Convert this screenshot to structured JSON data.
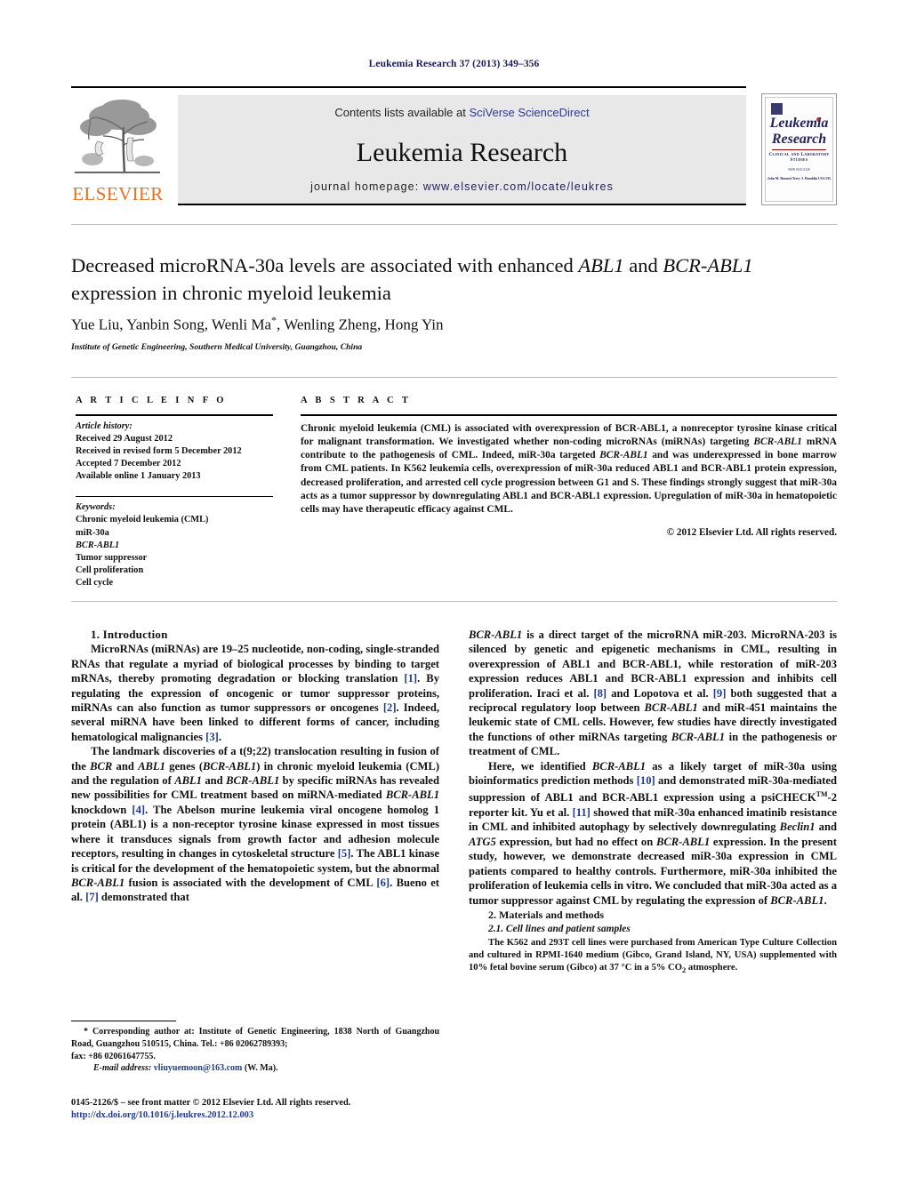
{
  "running_head": "Leukemia Research 37 (2013) 349–356",
  "masthead": {
    "contents_prefix": "Contents lists available at ",
    "contents_link": "SciVerse ScienceDirect",
    "journal_name": "Leukemia Research",
    "homepage_label": "journal homepage: ",
    "homepage_url": "www.elsevier.com/locate/leukres",
    "publisher_logo_text": "ELSEVIER",
    "cover": {
      "title_line1": "Leukemia",
      "title_line2": "Research",
      "subtitle": "Clinical and Laboratory Studies",
      "issn_line": "ISSN 0145-2126",
      "editors": "John M. Bennett          Terry J. Hamblin\nUSA                                 UK"
    }
  },
  "article": {
    "title_part1": "Decreased microRNA-30a levels are associated with enhanced ",
    "title_italic1": "ABL1",
    "title_part2": " and ",
    "title_italic2": "BCR-ABL1",
    "title_part3": " expression in chronic myeloid leukemia",
    "authors": "Yue Liu, Yanbin Song, Wenli Ma",
    "corresponding_mark": "*",
    "authors_rest": ", Wenling Zheng, Hong Yin",
    "affiliation": "Institute of Genetic Engineering, Southern Medical University, Guangzhou, China"
  },
  "article_info": {
    "heading": "A R T I C L E   I N F O",
    "history_label": "Article history:",
    "history": [
      "Received 29 August 2012",
      "Received in revised form 5 December 2012",
      "Accepted 7 December 2012",
      "Available online 1 January 2013"
    ],
    "keywords_label": "Keywords:",
    "keywords": [
      "Chronic myeloid leukemia (CML)",
      "miR-30a",
      "BCR-ABL1",
      "Tumor suppressor",
      "Cell proliferation",
      "Cell cycle"
    ],
    "keyword_italic_index": 2
  },
  "abstract": {
    "heading": "A B S T R A C T",
    "segments": [
      {
        "t": "Chronic myeloid leukemia (CML) is associated with overexpression of BCR-ABL1, a nonreceptor tyrosine kinase critical for malignant transformation. We investigated whether non-coding microRNAs (miRNAs) targeting "
      },
      {
        "t": "BCR-ABL1",
        "i": true
      },
      {
        "t": " mRNA contribute to the pathogenesis of CML. Indeed, miR-30a targeted "
      },
      {
        "t": "BCR-ABL1",
        "i": true
      },
      {
        "t": " and was underexpressed in bone marrow from CML patients. In K562 leukemia cells, overexpression of miR-30a reduced ABL1 and BCR-ABL1 protein expression, decreased proliferation, and arrested cell cycle progression between G1 and S. These findings strongly suggest that miR-30a acts as a tumor suppressor by downregulating ABL1 and BCR-ABL1 expression. Upregulation of miR-30a in hematopoietic cells may have therapeutic efficacy against CML."
      }
    ],
    "copyright": "© 2012 Elsevier Ltd. All rights reserved."
  },
  "body": {
    "intro_heading": "1.  Introduction",
    "intro_p1": [
      {
        "t": "MicroRNAs (miRNAs) are 19–25 nucleotide, non-coding, single-stranded RNAs that regulate a myriad of biological processes by binding to target mRNAs, thereby promoting degradation or blocking translation "
      },
      {
        "t": "[1]",
        "r": true
      },
      {
        "t": ". By regulating the expression of oncogenic or tumor suppressor proteins, miRNAs can also function as tumor suppressors or oncogenes "
      },
      {
        "t": "[2]",
        "r": true
      },
      {
        "t": ". Indeed, several miRNA have been linked to different forms of cancer, including hematological malignancies "
      },
      {
        "t": "[3]",
        "r": true
      },
      {
        "t": "."
      }
    ],
    "intro_p2": [
      {
        "t": "The landmark discoveries of a t(9;22) translocation resulting in fusion of the "
      },
      {
        "t": "BCR",
        "i": true
      },
      {
        "t": " and "
      },
      {
        "t": "ABL1",
        "i": true
      },
      {
        "t": " genes ("
      },
      {
        "t": "BCR-ABL1",
        "i": true
      },
      {
        "t": ") in chronic myeloid leukemia (CML) and the regulation of "
      },
      {
        "t": "ABL1",
        "i": true
      },
      {
        "t": " and "
      },
      {
        "t": "BCR-ABL1",
        "i": true
      },
      {
        "t": " by specific miRNAs has revealed new possibilities for CML treatment based on miRNA-mediated "
      },
      {
        "t": "BCR-ABL1",
        "i": true
      },
      {
        "t": " knockdown "
      },
      {
        "t": "[4]",
        "r": true
      },
      {
        "t": ". The Abelson murine leukemia viral oncogene homolog 1 protein (ABL1) is a non-receptor tyrosine kinase expressed in most tissues where it transduces signals from growth factor and adhesion molecule receptors, resulting in changes in cytoskeletal structure "
      },
      {
        "t": "[5]",
        "r": true
      },
      {
        "t": ". The ABL1 kinase is critical for the development of the hematopoietic system, but the abnormal "
      },
      {
        "t": "BCR-ABL1",
        "i": true
      },
      {
        "t": " fusion is associated with the development of CML "
      },
      {
        "t": "[6]",
        "r": true
      },
      {
        "t": ". Bueno et al. "
      },
      {
        "t": "[7]",
        "r": true
      },
      {
        "t": " demonstrated that"
      }
    ],
    "right_p1": [
      {
        "t": "BCR-ABL1",
        "i": true
      },
      {
        "t": " is a direct target of the microRNA miR-203. MicroRNA-203 is silenced by genetic and epigenetic mechanisms in CML, resulting in overexpression of ABL1 and BCR-ABL1, while restoration of miR-203 expression reduces ABL1 and BCR-ABL1 expression and inhibits cell proliferation. Iraci et al. "
      },
      {
        "t": "[8]",
        "r": true
      },
      {
        "t": " and Lopotova et al. "
      },
      {
        "t": "[9]",
        "r": true
      },
      {
        "t": " both suggested that a reciprocal regulatory loop between "
      },
      {
        "t": "BCR-ABL1",
        "i": true
      },
      {
        "t": " and miR-451 maintains the leukemic state of CML cells. However, few studies have directly investigated the functions of other miRNAs targeting "
      },
      {
        "t": "BCR-ABL1",
        "i": true
      },
      {
        "t": " in the pathogenesis or treatment of CML."
      }
    ],
    "right_p2": [
      {
        "t": "Here, we identified "
      },
      {
        "t": "BCR-ABL1",
        "i": true
      },
      {
        "t": " as a likely target of miR-30a using bioinformatics prediction methods "
      },
      {
        "t": "[10]",
        "r": true
      },
      {
        "t": " and demonstrated miR-30a-mediated suppression of ABL1 and BCR-ABL1 expression using a psiCHECK"
      },
      {
        "t": "TM",
        "sup": true
      },
      {
        "t": "-2 reporter kit. Yu et al. "
      },
      {
        "t": "[11]",
        "r": true
      },
      {
        "t": " showed that miR-30a enhanced imatinib resistance in CML and inhibited autophagy by selectively downregulating "
      },
      {
        "t": "Beclin1",
        "i": true
      },
      {
        "t": " and "
      },
      {
        "t": "ATG5",
        "i": true
      },
      {
        "t": " expression, but had no effect on "
      },
      {
        "t": "BCR-ABL1",
        "i": true
      },
      {
        "t": " expression. In the present study, however, we demonstrate decreased miR-30a expression in CML patients compared to healthy controls. Furthermore, miR-30a inhibited the proliferation of leukemia cells in vitro. We concluded that miR-30a acted as a tumor suppressor against CML by regulating the expression of "
      },
      {
        "t": "BCR-ABL1",
        "i": true
      },
      {
        "t": "."
      }
    ],
    "methods_heading": "2.  Materials and methods",
    "methods_sub": "2.1.   Cell lines and patient samples",
    "methods_p1_a": "The K562 and 293T cell lines were purchased from American Type Culture Collection and cultured in RPMI-1640 medium (Gibco, Grand Island, NY, USA) supplemented with 10% fetal bovine serum (Gibco) at 37 °C in a 5% CO",
    "methods_p1_sub": "2",
    "methods_p1_b": " atmosphere."
  },
  "footnote": {
    "text": "* Corresponding author at: Institute of Genetic Engineering, 1838 North of Guangzhou Road, Guangzhou 510515, China. Tel.: +86 02062789393;",
    "fax": "fax: +86 02061647755.",
    "email_label": "E-mail address:",
    "email": "vliuyuemoon@163.com",
    "email_suffix": " (W. Ma)."
  },
  "imprint": {
    "line1": "0145-2126/$ – see front matter © 2012 Elsevier Ltd. All rights reserved.",
    "doi": "http://dx.doi.org/10.1016/j.leukres.2012.12.003"
  },
  "colors": {
    "link_blue": "#1f3a93",
    "header_navy": "#1a1a5e",
    "elsevier_orange": "#E9711C",
    "masthead_gray": "#e8e8e8"
  }
}
